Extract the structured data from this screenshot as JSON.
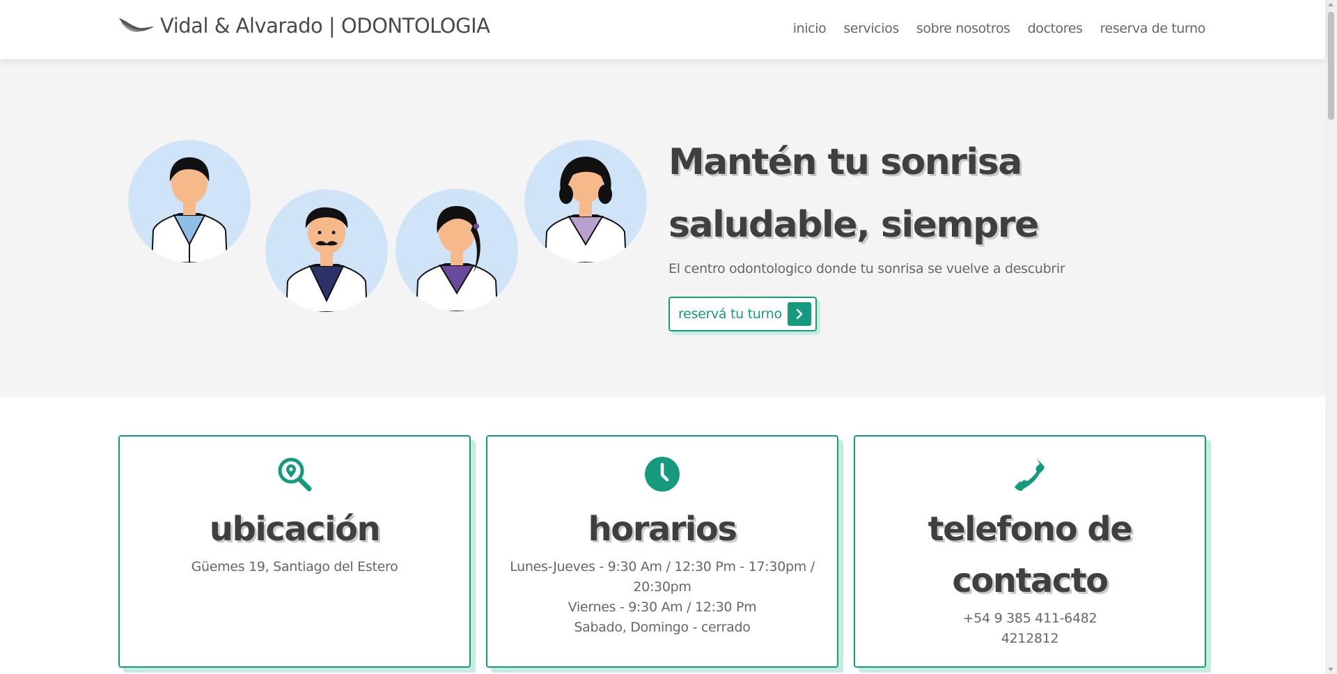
{
  "navbar": {
    "brand": "Vidal & Alvarado | ODONTOLOGIA",
    "logo_icon": "bird-logo-icon",
    "links": [
      "inicio",
      "servicios",
      "sobre nosotros",
      "doctores",
      "reserva de turno"
    ]
  },
  "hero": {
    "title": "Mantén tu sonrisa saludable, siempre",
    "subtitle": "El centro odontologico donde tu sonrisa se vuelve a descubrir",
    "cta_label": "reservá tu turno",
    "cta_icon": "chevron-right-icon",
    "avatars": [
      {
        "name": "doctor-male-avatar",
        "scrub": "#8fbfe6"
      },
      {
        "name": "doctor-mustache-avatar",
        "scrub": "#2c3168"
      },
      {
        "name": "doctor-female-ponytail-avatar",
        "scrub": "#6a4a9c"
      },
      {
        "name": "doctor-female-avatar",
        "scrub": "#b8a0cf"
      }
    ]
  },
  "cards": [
    {
      "icon": "location-search-icon",
      "title": "ubicación",
      "lines": [
        "Güemes 19, Santiago del Estero"
      ]
    },
    {
      "icon": "clock-icon",
      "title": "horarios",
      "lines": [
        "Lunes-Jueves - 9:30 Am / 12:30 Pm - 17:30pm / 20:30pm",
        "Viernes - 9:30 Am / 12:30 Pm",
        "Sabado, Domingo - cerrado"
      ]
    },
    {
      "icon": "phone-icon",
      "title": "telefono de contacto",
      "lines": [
        "+54 9 385 411-6482",
        "4212812"
      ]
    }
  ],
  "colors": {
    "accent": "#169a7e",
    "accent_shadow": "#c6ebdf",
    "hero_bg": "#f4f4f4",
    "avatar_bg": "#cfe5f7",
    "text_dark": "#3f3f3f",
    "text_muted": "#666666"
  }
}
